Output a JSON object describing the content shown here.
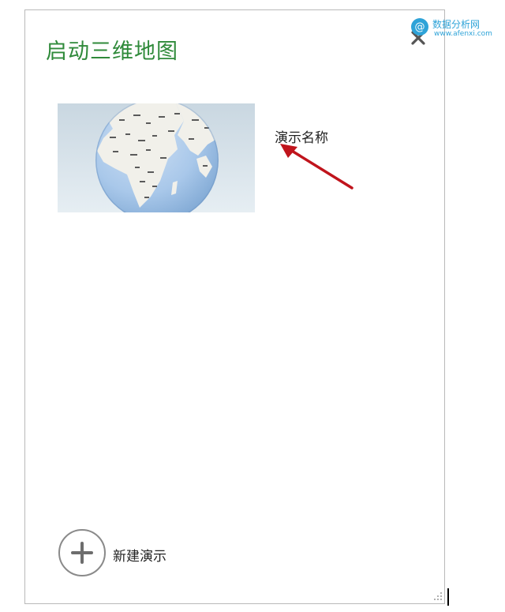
{
  "dialog": {
    "title": "启动三维地图",
    "close_icon": "close-icon"
  },
  "tours": [
    {
      "name": "演示名称",
      "thumbnail_icon": "globe-thumbnail"
    }
  ],
  "new_tour": {
    "label": "新建演示",
    "icon": "plus-circle-icon"
  },
  "annotation": {
    "arrow_color": "#c0141c"
  },
  "watermark": {
    "name": "数据分析网",
    "url": "www.afenxi.com"
  },
  "colors": {
    "title_green": "#2f8a3a",
    "watermark_blue": "#2ea3d8"
  }
}
